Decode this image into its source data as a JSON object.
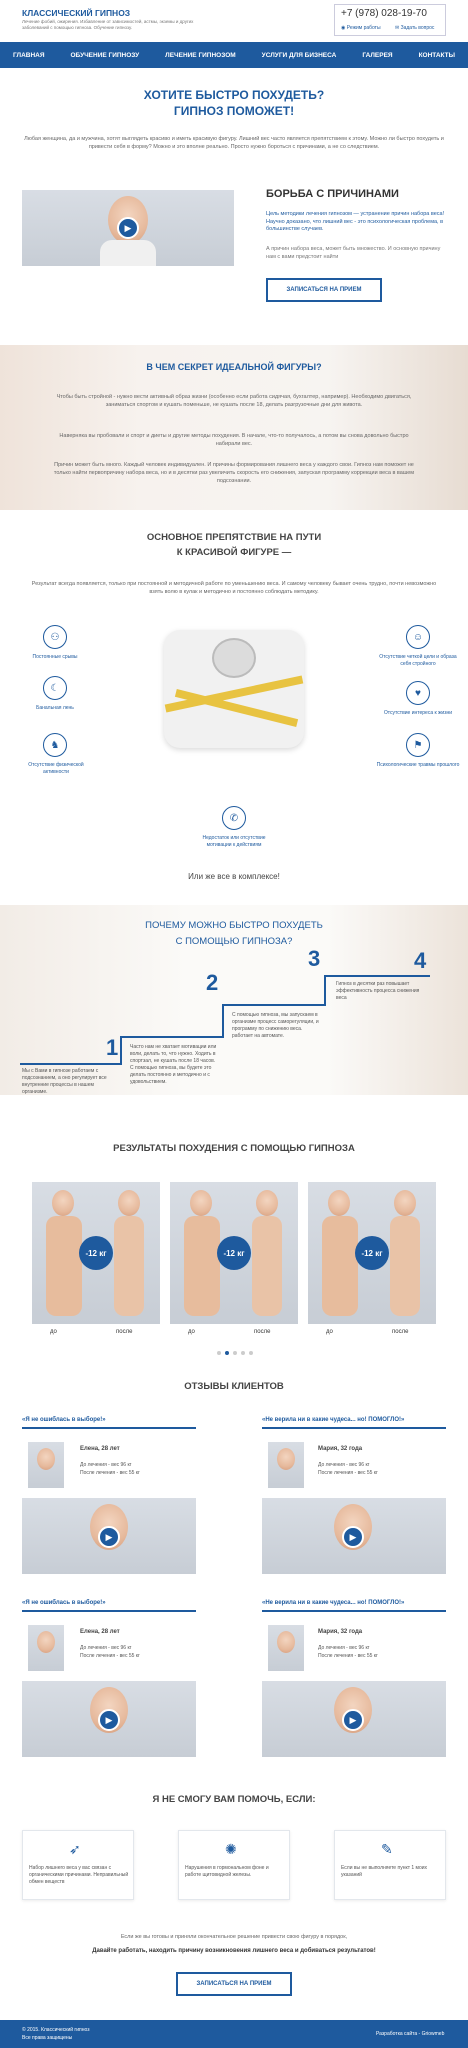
{
  "header": {
    "logo": "КЛАССИЧЕСКИЙ ГИПНОЗ",
    "tagline": "Лечение фобий, ожирения. Избавление от зависимостей, астмы, экземы и других заболеваний с помощью гипноза. Обучение гипнозу.",
    "phone": "+7 (978) 028-19-70",
    "schedule": "Режим работы",
    "ask": "Задать вопрос"
  },
  "nav": [
    "ГЛАВНАЯ",
    "ОБУЧЕНИЕ ГИПНОЗУ",
    "ЛЕЧЕНИЕ ГИПНОЗОМ",
    "УСЛУГИ ДЛЯ БИЗНЕСА",
    "ГАЛЕРЕЯ",
    "КОНТАКТЫ"
  ],
  "hero": {
    "title1": "ХОТИТЕ БЫСТРО ПОХУДЕТЬ?",
    "title2": "ГИПНОЗ ПОМОЖЕТ!",
    "text": "Любая женщина, да и мужчина, хотят выглядеть красиво и иметь красивую фигуру. Лишний вес часто является препятствием к этому. Можно ли быстро похудеть и привести себя в форму? Можно и это вполне реально. Просто нужно бороться с причинами, а не со следствием."
  },
  "fight": {
    "title": "БОРЬБА С ПРИЧИНАМИ",
    "text1": "Цель методики лечения гипнозом — устранение причин набора веса! Научно доказано, что лишний вес - это психологическая проблема, в большинстве случаев.",
    "text2": "А причин набора веса, может быть множество. И основную причину нам с вами предстоит найти",
    "button": "ЗАПИСАТЬСЯ НА ПРИЕМ"
  },
  "secret": {
    "title": "В ЧЕМ СЕКРЕТ ИДЕАЛЬНОЙ ФИГУРЫ?",
    "p1": "Чтобы быть стройной - нужно вести активный образ жизни (особенно если работа сидячая, бухгалтер, например). Необходимо двигаться, заниматься спортом и кушать поменьше, не кушать после 18, делать разгрузочные дни для живота.",
    "p2": "Наверняка вы пробовали и спорт и диеты и другие методы похудения. В начале, что-то получалось, а потом вы снова довольно быстро набирали вес.",
    "p3": "Причин может быть много. Каждый человек индивидуален. И причины формирования лишнего веса у каждого свои. Гипноз нам поможет не только найти первопричину набора веса, но и в десятки раз увеличить скорость его снижения, запуская программу коррекции веса в вашем подсознании."
  },
  "obstacle": {
    "title1": "ОСНОВНОЕ ПРЕПЯТСТВИЕ НА ПУТИ",
    "title2": "К КРАСИВОЙ ФИГУРЕ —",
    "text": "Результат всегда появляется, только при постоянной и методичной работе по уменьшению веса. И самому человеку бывает очень трудно, почти невозможно взять волю в кулак и методично и постоянно соблюдать методику.",
    "items": [
      "Постоянные срывы",
      "Банальная лень",
      "Отсутствие физической активности",
      "Отсутствие четкой цели и образа себя стройного",
      "Отсутствие интереса к жизни",
      "Психологические травмы прошлого",
      "Недостаток или отсутствие мотивации к действиям"
    ],
    "footer": "Или же все в комплексе!"
  },
  "why": {
    "title1": "ПОЧЕМУ МОЖНО БЫСТРО ПОХУДЕТЬ",
    "title2": "С ПОМОЩЬЮ ГИПНОЗА?",
    "steps": [
      {
        "n": "1",
        "t": "Мы с Вами в гипнозе работаем с подсознанием, а оно регулирует все внутренние процессы в нашем организме."
      },
      {
        "n": "2",
        "t": "Часто нам не хватает мотивации или воли, делать то, что нужно. Ходить в спортзал, не кушать после 18 часов. С помощью гипноза, вы будете это делать постоянно и методично и с удовольствием."
      },
      {
        "n": "3",
        "t": "С помощью гипноза, мы запускаем в организме процесс саморегуляции, и программу по снижению веса. работает на автомате."
      },
      {
        "n": "4",
        "t": "Гипноз в десятки раз повышает эффективность процесса снижения веса"
      }
    ]
  },
  "results": {
    "title": "РЕЗУЛЬТАТЫ ПОХУДЕНИЯ С ПОМОЩЬЮ ГИПНОЗА",
    "badge": "-12 кг",
    "before": "до",
    "after": "после"
  },
  "reviews": {
    "title": "ОТЗЫВЫ КЛИЕНТОВ",
    "items": [
      {
        "title": "«Я не ошиблась в выборе!»",
        "name": "Елена, 28 лет",
        "b": "До лечения - вес 96 кг",
        "a": "После лечения - вес 55 кг"
      },
      {
        "title": "«Не верила ни в какие чудеса... но! ПОМОГЛО!»",
        "name": "Мария, 32 года",
        "b": "До лечения - вес 96 кг",
        "a": "После лечения - вес 55 кг"
      },
      {
        "title": "«Я не ошиблась в выборе!»",
        "name": "Елена, 28 лет",
        "b": "До лечения - вес 96 кг",
        "a": "После лечения - вес 55 кг"
      },
      {
        "title": "«Не верила ни в какие чудеса... но! ПОМОГЛО!»",
        "name": "Мария, 32 года",
        "b": "До лечения - вес 96 кг",
        "a": "После лечения - вес 55 кг"
      }
    ]
  },
  "cant": {
    "title": "Я НЕ СМОГУ ВАМ ПОМОЧЬ, ЕСЛИ:",
    "items": [
      "Набор лишнего веса у вас связан с органическими причинами. Неправильный обмен веществ",
      "Нарушения в гормональном фоне и работе щитовидной железы.",
      "Если вы не выполняете пункт 1 моих указаний"
    ],
    "text1": "Если же вы готовы и приняли окончательное решение привести свою фигуру в порядок,",
    "text2": "Давайте работать, находить причину возникновения лишнего веса и добиваться результатов!",
    "button": "ЗАПИСАТЬСЯ НА ПРИЕМ"
  },
  "footer": {
    "copy": "© 2015. Классический гипноз",
    "rights": "Все права защищены",
    "dev": "Разработка сайта - Griowmeb"
  }
}
